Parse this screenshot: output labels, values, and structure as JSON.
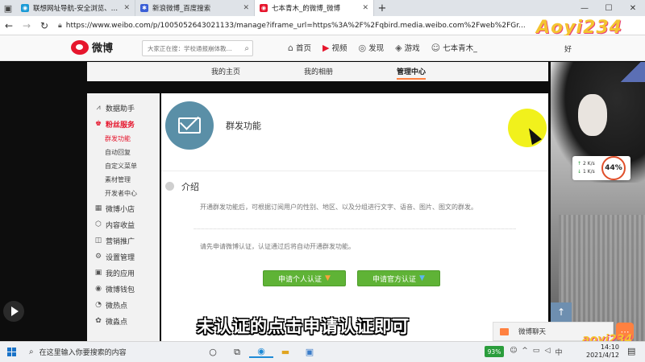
{
  "browser": {
    "tabs": [
      {
        "label": "联想网址导航-安全浏览、极速体",
        "favicon_color": "#1a9ad6",
        "active": false
      },
      {
        "label": "新浪微博_百度搜索",
        "favicon_color": "#3b5fd6",
        "active": false
      },
      {
        "label": "七本青木_的微博_微博",
        "favicon_color": "#e6162d",
        "active": true
      }
    ],
    "url": "https://www.weibo.com/p/1005052643021133/manage?iframe_url=https%3A%2F%2Fqbird.media.weibo.com%2Fweb%2FGr..."
  },
  "watermark": {
    "top": "Aoyi234",
    "bottom": "aoyi234"
  },
  "weibo_header": {
    "logo_text": "微博",
    "search_placeholder": "大家正在搜：学校通报崩体教...",
    "nav": [
      {
        "label": "首页",
        "icon": "home-icon"
      },
      {
        "label": "视频",
        "icon": "video-icon"
      },
      {
        "label": "发现",
        "icon": "discover-icon"
      },
      {
        "label": "游戏",
        "icon": "game-icon"
      },
      {
        "label": "七本青木_",
        "icon": "user-icon"
      }
    ],
    "right_label": "好"
  },
  "subnav": {
    "items": [
      "我的主页",
      "我的相册",
      "管理中心"
    ],
    "active": "管理中心"
  },
  "sidebar": {
    "items": [
      {
        "label": "数据助手",
        "icon": "chart-icon"
      },
      {
        "label": "粉丝服务",
        "icon": "fans-icon",
        "active": true,
        "children": [
          "群发功能",
          "自动回复",
          "自定义菜单",
          "素材管理",
          "开发者中心"
        ],
        "active_child": "群发功能"
      },
      {
        "label": "微博小店",
        "icon": "shop-icon"
      },
      {
        "label": "内容收益",
        "icon": "income-icon"
      },
      {
        "label": "营销推广",
        "icon": "promote-icon"
      },
      {
        "label": "设置管理",
        "icon": "settings-icon"
      },
      {
        "label": "我的应用",
        "icon": "apps-icon"
      },
      {
        "label": "微博钱包",
        "icon": "wallet-icon"
      },
      {
        "label": "微热点",
        "icon": "hot-icon"
      },
      {
        "label": "微淼点",
        "icon": "point-icon"
      }
    ]
  },
  "content": {
    "title": "群发功能",
    "intro_label": "介绍",
    "intro_text": "开通群发功能后，可根据订阅用户的性别、地区、以及分组进行文字、语音、图片、图文的群发。",
    "notice_text": "请先申请微博认证，认证通过后将自动开通群发功能。",
    "btn_personal": "申请个人认证",
    "btn_official": "申请官方认证"
  },
  "speed_widget": {
    "up": "2  K/s",
    "down": "1  K/s",
    "percent": "44%"
  },
  "subtitle": "未认证的点击申请认证即可",
  "chat": {
    "label": "微博聊天"
  },
  "taskbar": {
    "search_placeholder": "在这里输入你要搜索的内容",
    "battery": "93%",
    "time": "14:10",
    "date": "2021/4/12",
    "lang": "中"
  }
}
